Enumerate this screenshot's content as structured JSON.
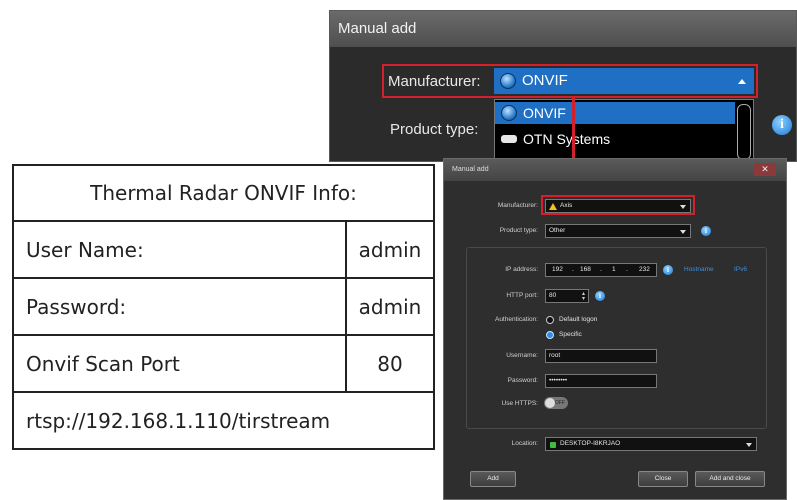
{
  "zoom_panel": {
    "title": "Manual add",
    "manufacturer_label": "Manufacturer:",
    "manufacturer_value": "ONVIF",
    "product_type_label": "Product type:",
    "dropdown_options": [
      "ONVIF",
      "OTN Systems"
    ]
  },
  "dialog": {
    "title": "Manual add",
    "close_label": "✕",
    "manufacturer_label": "Manufacturer:",
    "manufacturer_value": "Axis",
    "product_type_label": "Product type:",
    "product_type_value": "Other",
    "ip_label": "IP address:",
    "ip_octets": [
      "192",
      "168",
      "1",
      "232"
    ],
    "ip_separator": ".",
    "hostname_link": "Hostname",
    "ipv6_link": "IPv6",
    "http_port_label": "HTTP port:",
    "http_port_value": "80",
    "authentication_label": "Authentication:",
    "auth_default": "Default logon",
    "auth_specific": "Specific",
    "username_label": "Username:",
    "username_value": "root",
    "password_label": "Password:",
    "password_value": "••••••••",
    "use_https_label": "Use HTTPS:",
    "https_toggle": "OFF",
    "location_label": "Location:",
    "location_value": "DESKTOP-I8KRJAO",
    "add_button": "Add",
    "close_button": "Close",
    "add_and_close_button": "Add and close"
  },
  "info_table": {
    "title": "Thermal Radar ONVIF Info:",
    "rows": [
      {
        "label": "User Name:",
        "value": "admin"
      },
      {
        "label": "Password:",
        "value": "admin"
      },
      {
        "label": "Onvif Scan Port",
        "value": "80"
      }
    ],
    "rtsp_url": "rtsp://192.168.1.110/tirstream"
  },
  "colors": {
    "highlight_red": "#d4202a",
    "selection_blue": "#1f6fc4",
    "dialog_bg": "#2e2e2e"
  },
  "icons": {
    "manufacturer": "globe-icon",
    "axis": "axis-logo-icon",
    "help": "info-icon"
  }
}
